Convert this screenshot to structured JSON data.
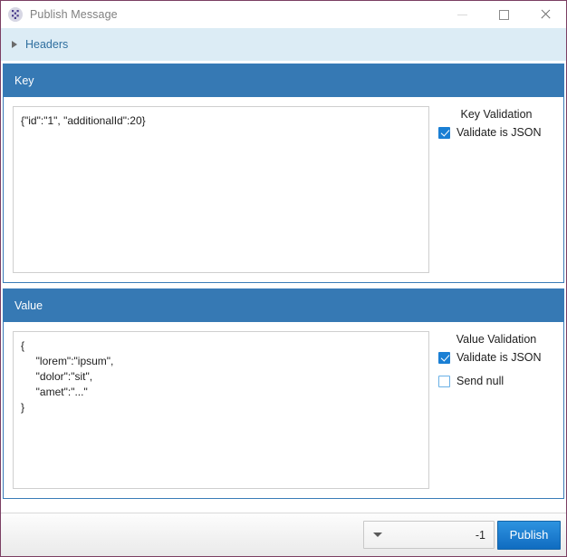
{
  "window": {
    "title": "Publish Message",
    "icon": "app-logo-icon",
    "controls": {
      "minimize": "minimize-icon",
      "maximize": "maximize-icon",
      "close": "close-icon"
    }
  },
  "headers_expander": {
    "label": "Headers",
    "expanded": false,
    "arrow": "chevron-right-icon"
  },
  "key_section": {
    "title": "Key",
    "editor_value": "{\"id\":\"1\", \"additionalId\":20}",
    "validation": {
      "title": "Key Validation",
      "options": [
        {
          "label": "Validate is JSON",
          "checked": true
        }
      ]
    }
  },
  "value_section": {
    "title": "Value",
    "editor_value": "{\n     \"lorem\":\"ipsum\",\n     \"dolor\":\"sit\",\n     \"amet\":\"...\"\n}",
    "validation": {
      "title": "Value Validation",
      "options": [
        {
          "label": "Validate is JSON",
          "checked": true
        },
        {
          "label": "Send null",
          "checked": false
        }
      ]
    }
  },
  "footer": {
    "partition_combo": {
      "value": "-1",
      "arrow": "chevron-down-icon"
    },
    "publish_label": "Publish"
  },
  "colors": {
    "window_border": "#7b3f63",
    "group_header": "#3679b4",
    "headers_bar": "#dcecf5",
    "link_text": "#2f6f9f",
    "accent_button": "#1f7fd1",
    "checkbox_checked": "#1a7fd4"
  }
}
